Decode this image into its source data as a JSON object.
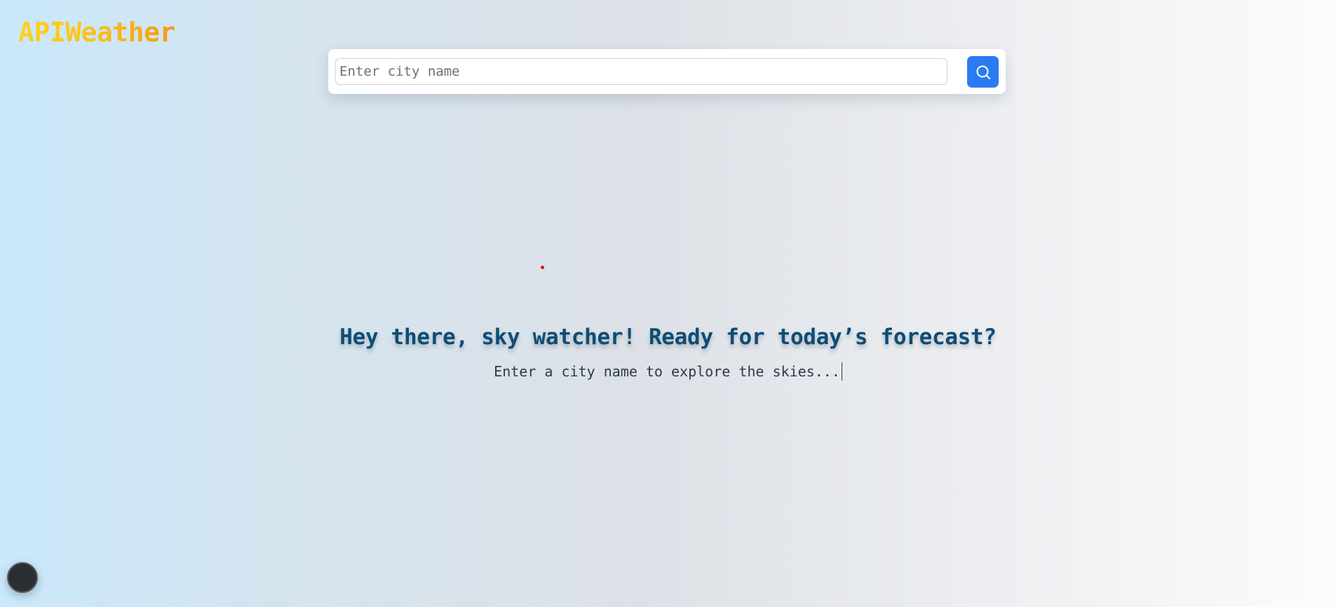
{
  "app": {
    "logo_text": "APIWeather"
  },
  "search": {
    "placeholder": "Enter city name",
    "value": "",
    "button_icon": "search-icon"
  },
  "hero": {
    "headline": "Hey there, sky watcher! Ready for today’s forecast?",
    "subline": "Enter a city name to explore the skies..."
  },
  "theme_toggle": {
    "icon": "dark-mode-toggle"
  },
  "colors": {
    "accent": "#2b7bf0",
    "headline": "#0d4d75",
    "logo_start": "#ffd21f",
    "logo_end": "#f59a12",
    "indicator_dot": "#e01414"
  }
}
